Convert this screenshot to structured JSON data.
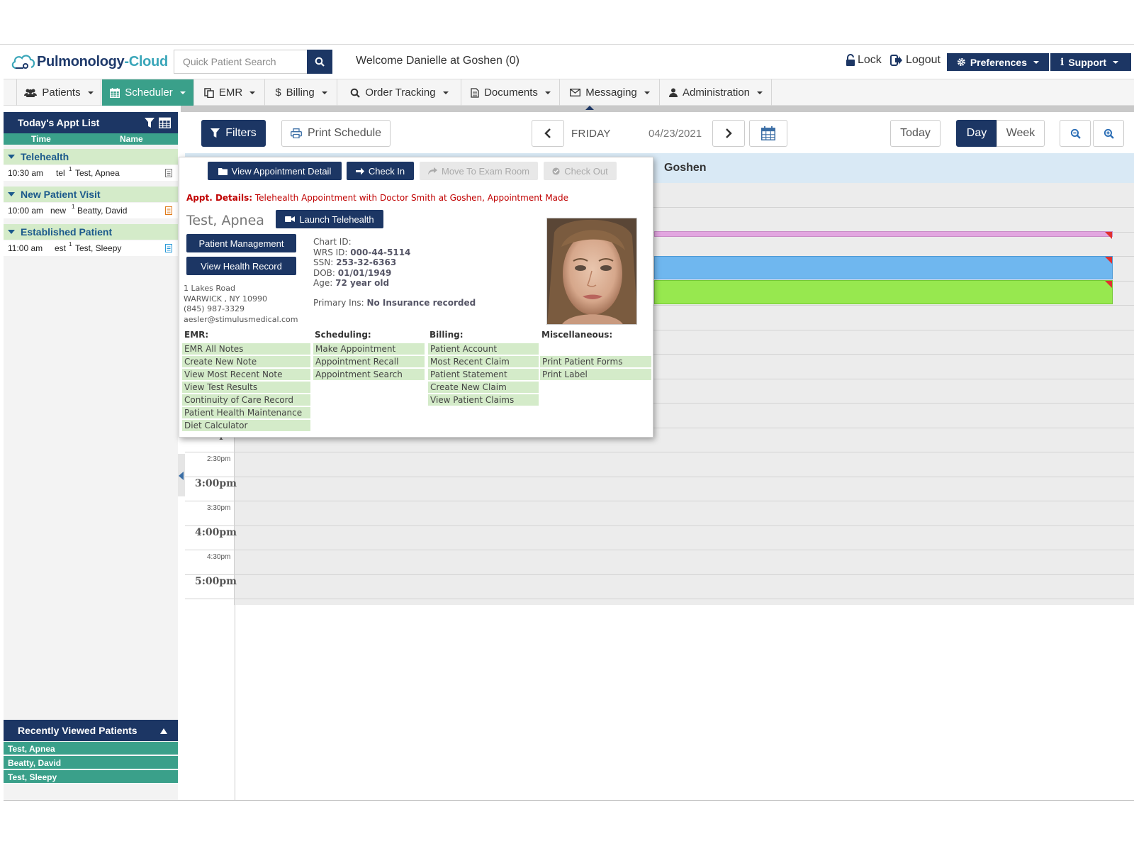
{
  "header": {
    "logo_part1": "Pulmonology",
    "logo_part2": "-Cloud",
    "search_placeholder": "Quick Patient Search",
    "welcome": "Welcome Danielle at Goshen (0)",
    "lock": "Lock",
    "logout": "Logout",
    "preferences": "Preferences",
    "support": "Support"
  },
  "nav": {
    "patients": "Patients",
    "scheduler": "Scheduler",
    "emr": "EMR",
    "billing": "Billing",
    "order_tracking": "Order Tracking",
    "documents": "Documents",
    "messaging": "Messaging",
    "administration": "Administration"
  },
  "appt_list": {
    "title": "Today's Appt List",
    "col_time": "Time",
    "col_name": "Name",
    "groups": [
      {
        "name": "Telehealth",
        "time": "10:30 am",
        "type": "tel",
        "sup": "1",
        "patient": "Test, Apnea"
      },
      {
        "name": "New Patient Visit",
        "time": "10:00 am",
        "type": "new",
        "sup": "1",
        "patient": "Beatty, David"
      },
      {
        "name": "Established Patient",
        "time": "11:00 am",
        "type": "est",
        "sup": "1",
        "patient": "Test, Sleepy"
      }
    ]
  },
  "recent": {
    "title": "Recently Viewed Patients",
    "items": [
      "Test, Apnea",
      "Beatty, David",
      "Test, Sleepy"
    ]
  },
  "toolbar": {
    "filters": "Filters",
    "print_schedule": "Print Schedule",
    "day_name": "FRIDAY",
    "date": "04/23/2021",
    "today": "Today",
    "day": "Day",
    "week": "Week"
  },
  "calendar": {
    "location": "Goshen",
    "times": [
      "2:00pm",
      "2:30pm",
      "3:00pm",
      "3:30pm",
      "4:00pm",
      "4:30pm",
      "5:00pm"
    ],
    "bar_colors": [
      "#e2a6e0",
      "#6fb7ef",
      "#97e84f"
    ]
  },
  "popup": {
    "btn_view_detail": "View Appointment Detail",
    "btn_check_in": "Check In",
    "btn_move_exam": "Move To Exam Room",
    "btn_check_out": "Check Out",
    "details_label": "Appt. Details:",
    "details_value": "Telehealth Appointment with Doctor Smith at Goshen, Appointment Made",
    "patient_name": "Test, Apnea",
    "btn_launch_telehealth": "Launch Telehealth",
    "btn_patient_mgmt": "Patient Management",
    "btn_view_health": "View Health Record",
    "address": [
      "1 Lakes Road",
      "WARWICK , NY 10990",
      "(845) 987-3329",
      "aesler@stimulusmedical.com"
    ],
    "chart_id_label": "Chart ID:",
    "wrs_label": "WRS ID:",
    "wrs_value": "000-44-5114",
    "ssn_label": "SSN:",
    "ssn_value": "253-32-6363",
    "dob_label": "DOB:",
    "dob_value": "01/01/1949",
    "age_label": "Age:",
    "age_value": "72 year old",
    "ins_label": "Primary Ins:",
    "ins_value": "No Insurance recorded",
    "emr_header": "EMR:",
    "emr_links": [
      "EMR All Notes",
      "Create New Note",
      "View Most Recent Note",
      "View Test Results",
      "Continuity of Care Record",
      "Patient Health Maintenance",
      "Diet Calculator"
    ],
    "sched_header": "Scheduling:",
    "sched_links": [
      "Make Appointment",
      "Appointment Recall",
      "Appointment Search"
    ],
    "billing_header": "Billing:",
    "billing_links": [
      "Patient Account",
      "Most Recent Claim",
      "Patient Statement",
      "Create New Claim",
      "View Patient Claims"
    ],
    "misc_header": "Miscellaneous:",
    "misc_links": [
      "Print Patient Forms",
      "Print Label"
    ]
  },
  "colors": {
    "navy": "#1c3664",
    "teal": "#3aa08a",
    "light_green": "#d4ebc9",
    "red_text": "#c00000"
  }
}
